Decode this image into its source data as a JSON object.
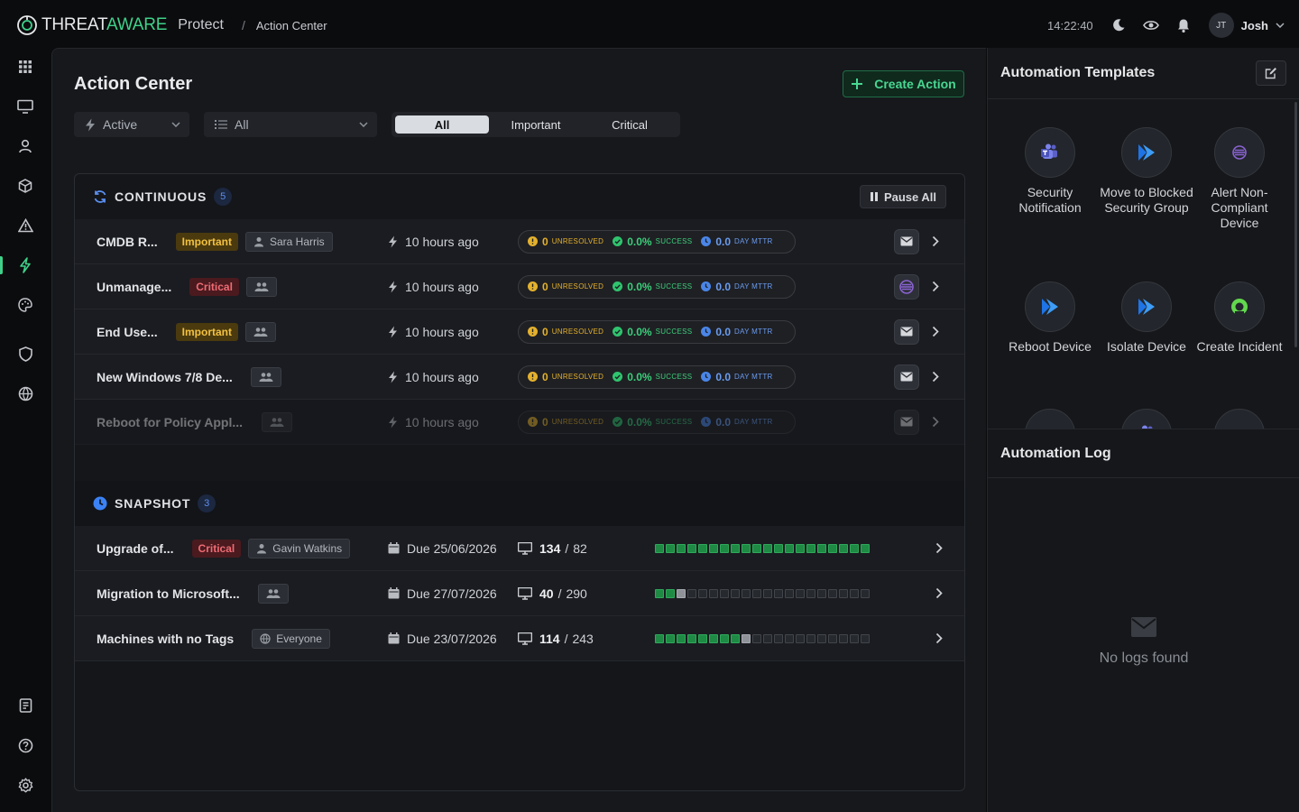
{
  "header": {
    "brand_part1": "THREAT",
    "brand_part2": "AWARE",
    "product": "Protect",
    "separator": "/",
    "breadcrumb": "Action Center",
    "clock": "14:22:40",
    "user_initials": "JT",
    "user_name": "Josh"
  },
  "nav": {
    "items": [
      "apps-grid-icon",
      "monitor-icon",
      "user-icon",
      "cube-icon",
      "warning-icon",
      "bolt-icon",
      "palette-icon",
      "shield-icon",
      "globe-icon",
      "book-icon",
      "help-icon",
      "settings-icon"
    ],
    "active": "bolt-icon"
  },
  "main": {
    "title": "Action Center",
    "create_label": "Create Action",
    "status_filter": "Active",
    "type_filter": "All",
    "segments": [
      "All",
      "Important",
      "Critical"
    ],
    "selected_segment": "All"
  },
  "continuous": {
    "title": "CONTINUOUS",
    "count": "5",
    "pause_label": "Pause All",
    "labels": {
      "unresolved": "UNRESOLVED",
      "success": "SUCCESS",
      "mttr": "DAY MTTR"
    },
    "rows": [
      {
        "name": "CMDB R...",
        "priority": "Important",
        "owner": "Sara Harris",
        "time": "10 hours ago",
        "unresolved": "0",
        "success": "0.0%",
        "mttr": "0.0",
        "action_icon": "mail-icon",
        "faded": false
      },
      {
        "name": "Unmanage...",
        "priority": "Critical",
        "owner": "",
        "time": "10 hours ago",
        "unresolved": "0",
        "success": "0.0%",
        "mttr": "0.0",
        "action_icon": "alert-noncompliant-icon",
        "faded": false
      },
      {
        "name": "End Use...",
        "priority": "Important",
        "owner": "",
        "time": "10 hours ago",
        "unresolved": "0",
        "success": "0.0%",
        "mttr": "0.0",
        "action_icon": "mail-icon",
        "faded": false
      },
      {
        "name": "New Windows 7/8 De...",
        "priority": "",
        "owner": "",
        "time": "10 hours ago",
        "unresolved": "0",
        "success": "0.0%",
        "mttr": "0.0",
        "action_icon": "mail-icon",
        "faded": false
      },
      {
        "name": "Reboot for Policy Appl...",
        "priority": "",
        "owner": "",
        "time": "10 hours ago",
        "unresolved": "0",
        "success": "0.0%",
        "mttr": "0.0",
        "action_icon": "mail-icon",
        "faded": true
      }
    ]
  },
  "snapshot": {
    "title": "SNAPSHOT",
    "count": "3",
    "rows": [
      {
        "name": "Upgrade of...",
        "priority": "Critical",
        "owner": "Gavin Watkins",
        "owner_icon": "user",
        "due": "Due 25/06/2026",
        "done": "134",
        "total": "82",
        "progress_done": 20,
        "progress_part": 0,
        "progress_total": 20
      },
      {
        "name": "Migration to Microsoft...",
        "priority": "",
        "owner": "",
        "owner_icon": "group",
        "due": "Due 27/07/2026",
        "done": "40",
        "total": "290",
        "progress_done": 2,
        "progress_part": 1,
        "progress_total": 20
      },
      {
        "name": "Machines with no Tags",
        "priority": "",
        "owner": "Everyone",
        "owner_icon": "globe",
        "due": "Due 23/07/2026",
        "done": "114",
        "total": "243",
        "progress_done": 8,
        "progress_part": 1,
        "progress_total": 20
      }
    ]
  },
  "templates": {
    "title": "Automation Templates",
    "items": [
      {
        "label": "Security Notification",
        "icon": "teams-icon"
      },
      {
        "label": "Move to Blocked Security Group",
        "icon": "azure-icon"
      },
      {
        "label": "Alert Non-Compliant Device",
        "icon": "alert-noncompliant-icon"
      },
      {
        "label": "Reboot Device",
        "icon": "azure-icon"
      },
      {
        "label": "Isolate Device",
        "icon": "azure-icon"
      },
      {
        "label": "Create Incident",
        "icon": "servicenow-icon"
      }
    ]
  },
  "log": {
    "title": "Automation Log",
    "empty_text": "No logs found"
  },
  "colors": {
    "accent": "#3fd18a",
    "important": "#f3c141",
    "critical": "#ef6b74",
    "info": "#4a86e8"
  }
}
